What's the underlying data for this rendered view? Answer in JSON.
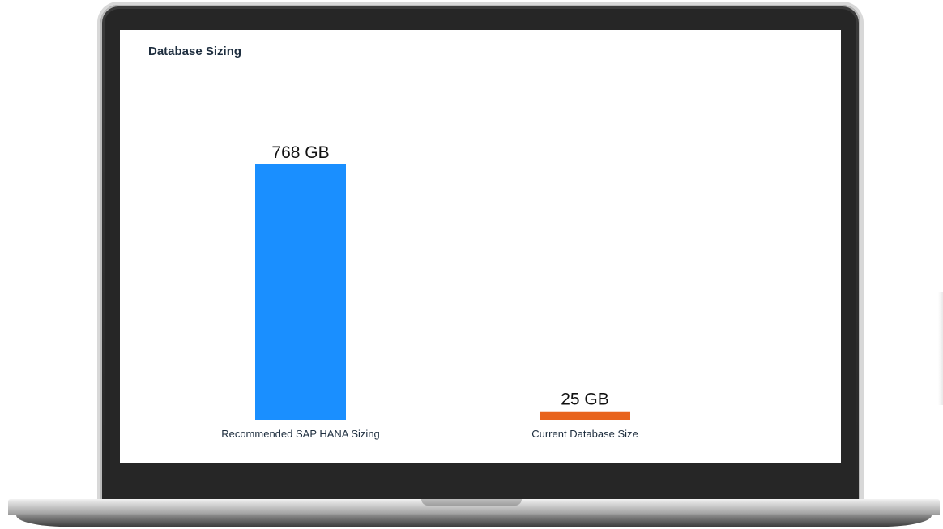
{
  "panel": {
    "title": "Database Sizing"
  },
  "chart_data": {
    "type": "bar",
    "categories": [
      "Recommended SAP HANA Sizing",
      "Current Database Size"
    ],
    "values": [
      768,
      25
    ],
    "value_labels": [
      "768 GB",
      "25 GB"
    ],
    "colors": [
      "#1a8fff",
      "#e8631c"
    ],
    "unit": "GB",
    "ylim": [
      0,
      768
    ],
    "grid": false,
    "legend": "none"
  }
}
